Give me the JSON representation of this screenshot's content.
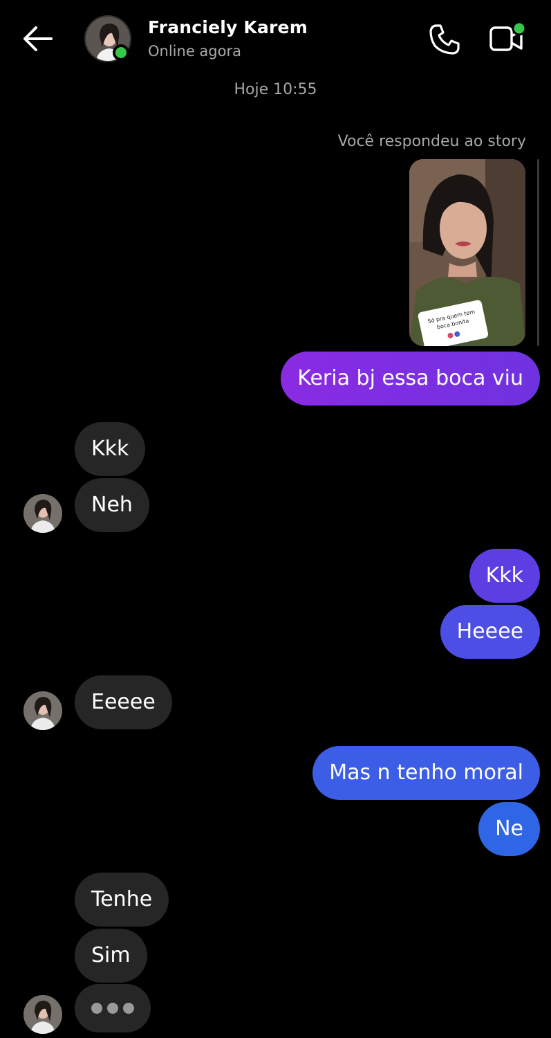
{
  "header": {
    "contact_name": "Franciely Karem",
    "status": "Online agora",
    "back_icon": "arrow-left-icon",
    "call_icon": "phone-icon",
    "video_icon": "video-camera-icon"
  },
  "conversation": {
    "timestamp": "Hoje 10:55",
    "story_reply_label": "Você respondeu ao story",
    "story_sticker_text": "Só pra quem tem boca bonita😏",
    "messages": [
      {
        "from": "me",
        "text": "Keria bj essa boca viu"
      },
      {
        "from": "them",
        "text": "Kkk"
      },
      {
        "from": "them",
        "text": "Neh"
      },
      {
        "from": "me",
        "text": "Kkk"
      },
      {
        "from": "me",
        "text": "Heeee"
      },
      {
        "from": "them",
        "text": "Eeeee"
      },
      {
        "from": "me",
        "text": "Mas n tenho moral"
      },
      {
        "from": "me",
        "text": "Ne"
      },
      {
        "from": "them",
        "text": "Tenhe"
      },
      {
        "from": "them",
        "text": "Sim"
      }
    ],
    "typing_indicator": true
  },
  "colors": {
    "background": "#000000",
    "incoming_bubble": "#262626",
    "outgoing_purple": "#7a2de0",
    "outgoing_blue": "#3a5fe6",
    "online": "#35c84a",
    "muted_text": "#a8a8a8"
  }
}
